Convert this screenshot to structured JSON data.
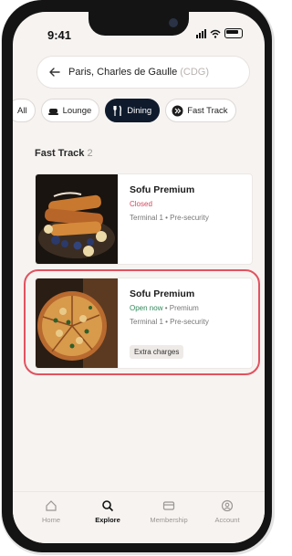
{
  "status_bar": {
    "time": "9:41"
  },
  "route": {
    "city": "Paris, Charles de Gaulle",
    "code": "(CDG)"
  },
  "filters": [
    {
      "label": "All",
      "icon": "all-icon",
      "active": false
    },
    {
      "label": "Lounge",
      "icon": "lounge-icon",
      "active": false
    },
    {
      "label": "Dining",
      "icon": "fork-knife-icon",
      "active": true
    },
    {
      "label": "Fast Track",
      "icon": "fast-track-icon",
      "active": false
    }
  ],
  "section": {
    "title": "Fast Track",
    "count": "2"
  },
  "cards": [
    {
      "title": "Sofu Premium",
      "status": "Closed",
      "status_color": "#d04a5f",
      "meta": "Terminal 1 • Pre-security",
      "image": "french-toast-image"
    },
    {
      "title": "Sofu Premium",
      "status": "Open now",
      "status_color": "#2e8a5a",
      "extra": "Premium",
      "meta": "Terminal 1 • Pre-security",
      "tag": "Extra charges",
      "image": "pizza-image"
    }
  ],
  "tabbar": [
    {
      "label": "Home",
      "icon": "home-icon",
      "active": false
    },
    {
      "label": "Explore",
      "icon": "search-icon",
      "active": true
    },
    {
      "label": "Membership",
      "icon": "card-icon",
      "active": false
    },
    {
      "label": "Account",
      "icon": "account-icon",
      "active": false
    }
  ],
  "colors": {
    "accent_dark": "#0f1b2d",
    "highlight": "#e2525f",
    "background": "#f6f3f1"
  }
}
